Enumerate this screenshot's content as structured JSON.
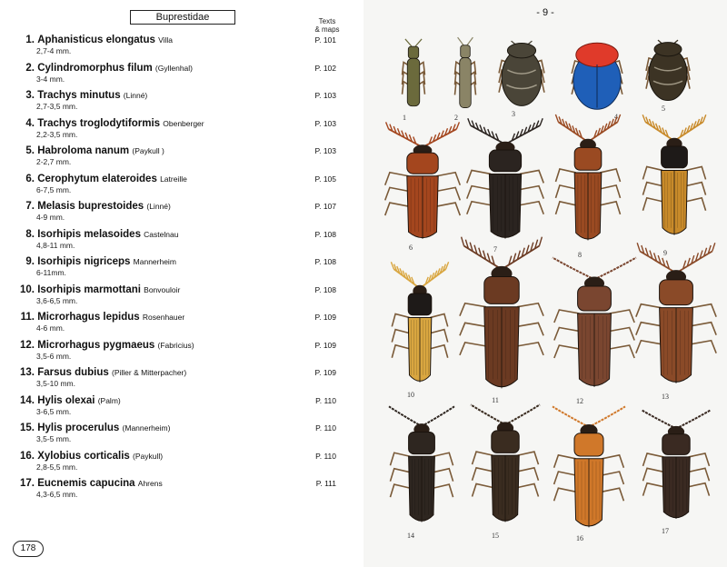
{
  "header": {
    "family": "Buprestidae",
    "texts_maps": [
      "Texts",
      "& maps"
    ]
  },
  "entries": [
    {
      "num": "1.",
      "name": "Aphanisticus elongatus",
      "author": "Villa",
      "size": "2,7-4 mm.",
      "page": "P. 101"
    },
    {
      "num": "2.",
      "name": "Cylindromorphus filum",
      "author": "(Gyllenhal)",
      "size": "3-4 mm.",
      "page": "P. 102"
    },
    {
      "num": "3.",
      "name": "Trachys minutus",
      "author": "(Linné)",
      "size": "2,7-3,5 mm.",
      "page": "P. 103"
    },
    {
      "num": "4.",
      "name": "Trachys troglodytiformis",
      "author": "Obenberger",
      "size": "2,2-3,5 mm.",
      "page": "P. 103"
    },
    {
      "num": "5.",
      "name": "Habroloma nanum",
      "author": "(Paykull )",
      "size": "2-2,7 mm.",
      "page": "P. 103"
    },
    {
      "num": "6.",
      "name": "Cerophytum elateroides",
      "author": "Latreille",
      "size": "6-7,5 mm.",
      "page": "P. 105"
    },
    {
      "num": "7.",
      "name": "Melasis buprestoides",
      "author": "(Linné)",
      "size": "4-9 mm.",
      "page": "P. 107"
    },
    {
      "num": "8.",
      "name": "Isorhipis melasoides",
      "author": "Castelnau",
      "size": "4,8-11 mm.",
      "page": "P. 108"
    },
    {
      "num": "9.",
      "name": "Isorhipis nigriceps",
      "author": "Mannerheim",
      "size": "6-11mm.",
      "page": "P. 108"
    },
    {
      "num": "10.",
      "name": "Isorhipis marmottani",
      "author": "Bonvouloir",
      "size": "3,6-6,5 mm.",
      "page": "P. 108"
    },
    {
      "num": "11.",
      "name": "Microrhagus lepidus",
      "author": "Rosenhauer",
      "size": "4-6 mm.",
      "page": "P. 109"
    },
    {
      "num": "12.",
      "name": "Microrhagus pygmaeus",
      "author": "(Fabricius)",
      "size": "3,5-6 mm.",
      "page": "P. 109"
    },
    {
      "num": "13.",
      "name": "Farsus dubius",
      "author": "(Piller & Mitterpacher)",
      "size": "3,5-10 mm.",
      "page": "P. 109"
    },
    {
      "num": "14.",
      "name": "Hylis olexai",
      "author": "(Palm)",
      "size": "3-6,5 mm.",
      "page": "P. 110"
    },
    {
      "num": "15.",
      "name": "Hylis procerulus",
      "author": "(Mannerheim)",
      "size": "3,5-5 mm.",
      "page": "P. 110"
    },
    {
      "num": "16.",
      "name": "Xylobius corticalis",
      "author": "(Paykull)",
      "size": "2,8-5,5 mm.",
      "page": "P. 110"
    },
    {
      "num": "17.",
      "name": "Eucnemis capucina",
      "author": "Ahrens",
      "size": "4,3-6,5 mm.",
      "page": "P. 111"
    }
  ],
  "page_left": "178",
  "page_right": "- 9 -",
  "plate_labels": [
    "1",
    "2",
    "3",
    "4",
    "5",
    "6",
    "7",
    "8",
    "9",
    "10",
    "11",
    "12",
    "13",
    "14",
    "15",
    "16",
    "17"
  ],
  "colors": {
    "beetle1": "#6b6a3c",
    "beetle2": "#8a8466",
    "beetle3": "#4a4538",
    "beetle4_head": "#e03a2a",
    "beetle4_body": "#1f5fb8",
    "beetle5": "#3c3324",
    "beetle6": "#a4461e",
    "beetle7": "#2b2420",
    "beetle8": "#9a4a22",
    "beetle9": "#c88a2a",
    "beetle10": "#d9a640",
    "beetle11": "#6b3a22",
    "beetle12": "#7a4630",
    "beetle13": "#8a4a28",
    "beetle14": "#2e2620",
    "beetle15": "#3a2c20",
    "beetle16": "#d0782a",
    "beetle17": "#3a2a22"
  }
}
